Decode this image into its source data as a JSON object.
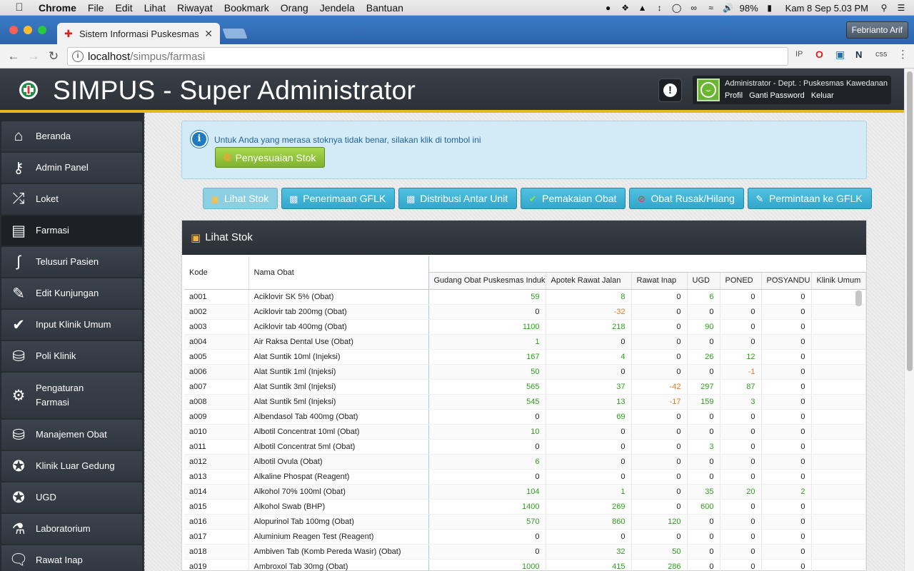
{
  "menubar": {
    "app": "Chrome",
    "items": [
      "File",
      "Edit",
      "Lihat",
      "Riwayat",
      "Bookmark",
      "Orang",
      "Jendela",
      "Bantuan"
    ],
    "battery": "98%",
    "clock": "Kam 8 Sep  5.03 PM"
  },
  "browser": {
    "tab_title": "Sistem Informasi Puskesmas",
    "url_host": "localhost",
    "url_path": "/simpus/farmasi",
    "profile_name": "Febrianto Arif",
    "ext_ip": "IP",
    "ext_css": "css"
  },
  "header": {
    "title": "SIMPUS - Super Administrator",
    "user_line": "Administrator - Dept. : Puskesmas Kawedanan",
    "links": [
      "Profil",
      "Ganti Password",
      "Keluar"
    ]
  },
  "sidebar": {
    "items": [
      {
        "label": "Beranda",
        "icon": "home-icon"
      },
      {
        "label": "Admin Panel",
        "icon": "key-icon"
      },
      {
        "label": "Loket",
        "icon": "shuffle-icon"
      },
      {
        "label": "Farmasi",
        "icon": "clipboard-icon"
      },
      {
        "label": "Telusuri Pasien",
        "icon": "stethoscope-icon"
      },
      {
        "label": "Edit Kunjungan",
        "icon": "pencil-icon"
      },
      {
        "label": "Input Klinik Umum",
        "icon": "check-icon"
      },
      {
        "label": "Poli Klinik",
        "icon": "database-icon"
      },
      {
        "label": "Pengaturan",
        "label2": "Farmasi",
        "icon": "gear-icon"
      },
      {
        "label": "Manajemen Obat",
        "icon": "database-icon"
      },
      {
        "label": "Klinik Luar Gedung",
        "icon": "person-icon"
      },
      {
        "label": "UGD",
        "icon": "person-icon"
      },
      {
        "label": "Laboratorium",
        "icon": "flask-icon"
      },
      {
        "label": "Rawat Inap",
        "icon": "chat-icon"
      }
    ]
  },
  "notice": {
    "text": "Untuk Anda yang merasa stoknya tidak benar, silakan klik di tombol ini",
    "button": "Penyesuaian Stok"
  },
  "actions": [
    {
      "label": "Lihat Stok",
      "icon": "box-icon"
    },
    {
      "label": "Penerimaan GFLK",
      "icon": "inbox-icon"
    },
    {
      "label": "Distribusi Antar Unit",
      "icon": "transfer-icon"
    },
    {
      "label": "Pemakaian Obat",
      "icon": "check-icon"
    },
    {
      "label": "Obat Rusak/Hilang",
      "icon": "forbidden-icon"
    },
    {
      "label": "Permintaan ke GFLK",
      "icon": "edit-icon"
    }
  ],
  "panel": {
    "title": "Lihat Stok",
    "columns": {
      "kode": "Kode",
      "nama": "Nama Obat",
      "units": [
        "Gudang Obat Puskesmas Induk",
        "Apotek Rawat Jalan",
        "Rawat Inap",
        "UGD",
        "PONED",
        "POSYANDU",
        "Klinik Umum"
      ]
    },
    "rows": [
      {
        "kode": "a001",
        "nama": "Aciklovir SK 5% (Obat)",
        "v": [
          59,
          8,
          0,
          6,
          0,
          0
        ]
      },
      {
        "kode": "a002",
        "nama": "Aciklovir tab 200mg (Obat)",
        "v": [
          0,
          -32,
          0,
          0,
          0,
          0
        ]
      },
      {
        "kode": "a003",
        "nama": "Aciklovir tab 400mg (Obat)",
        "v": [
          1100,
          218,
          0,
          90,
          0,
          0
        ]
      },
      {
        "kode": "a004",
        "nama": "Air Raksa Dental Use (Obat)",
        "v": [
          1,
          0,
          0,
          0,
          0,
          0
        ]
      },
      {
        "kode": "a005",
        "nama": "Alat Suntik 10ml (Injeksi)",
        "v": [
          167,
          4,
          0,
          26,
          12,
          0
        ]
      },
      {
        "kode": "a006",
        "nama": "Alat Suntik 1ml (Injeksi)",
        "v": [
          50,
          0,
          0,
          0,
          -1,
          0
        ]
      },
      {
        "kode": "a007",
        "nama": "Alat Suntik 3ml (Injeksi)",
        "v": [
          565,
          37,
          -42,
          297,
          87,
          0
        ]
      },
      {
        "kode": "a008",
        "nama": "Alat Suntik 5ml (Injeksi)",
        "v": [
          545,
          13,
          -17,
          159,
          3,
          0
        ]
      },
      {
        "kode": "a009",
        "nama": "Albendasol Tab 400mg (Obat)",
        "v": [
          0,
          69,
          0,
          0,
          0,
          0
        ]
      },
      {
        "kode": "a010",
        "nama": "Albotil Concentrat 10ml (Obat)",
        "v": [
          10,
          0,
          0,
          0,
          0,
          0
        ]
      },
      {
        "kode": "a011",
        "nama": "Albotil Concentrat 5ml (Obat)",
        "v": [
          0,
          0,
          0,
          3,
          0,
          0
        ]
      },
      {
        "kode": "a012",
        "nama": "Albotil Ovula (Obat)",
        "v": [
          6,
          0,
          0,
          0,
          0,
          0
        ]
      },
      {
        "kode": "a013",
        "nama": "Alkaline Phospat (Reagent)",
        "v": [
          0,
          0,
          0,
          0,
          0,
          0
        ]
      },
      {
        "kode": "a014",
        "nama": "Alkohol 70% 100ml (Obat)",
        "v": [
          104,
          1,
          0,
          35,
          20,
          2
        ]
      },
      {
        "kode": "a015",
        "nama": "Alkohol Swab (BHP)",
        "v": [
          1400,
          269,
          0,
          600,
          0,
          0
        ]
      },
      {
        "kode": "a016",
        "nama": "Alopurinol Tab 100mg (Obat)",
        "v": [
          570,
          860,
          120,
          0,
          0,
          0
        ]
      },
      {
        "kode": "a017",
        "nama": "Aluminium Reagen Test (Reagent)",
        "v": [
          0,
          0,
          0,
          0,
          0,
          0
        ]
      },
      {
        "kode": "a018",
        "nama": "Ambiven Tab (Komb Pereda Wasir) (Obat)",
        "v": [
          0,
          32,
          50,
          0,
          0,
          0
        ]
      },
      {
        "kode": "a019",
        "nama": "Ambroxol Tab 30mg (Obat)",
        "v": [
          1000,
          415,
          286,
          0,
          0,
          0
        ]
      }
    ]
  }
}
